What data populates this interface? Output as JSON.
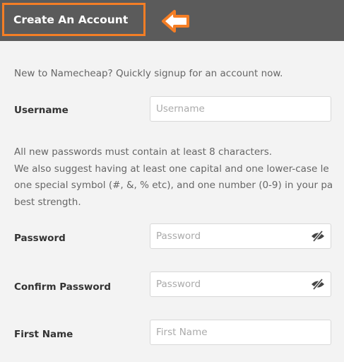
{
  "header": {
    "title": "Create An Account",
    "accent_color": "#f47e25",
    "bar_color": "#5b5b5b",
    "arrow_icon": "left-arrow-icon"
  },
  "intro_text": "New to Namecheap? Quickly signup for an account now.",
  "username": {
    "label": "Username",
    "placeholder": "Username",
    "value": ""
  },
  "password_help": [
    "All new passwords must contain at least 8 characters.",
    "We also suggest having at least one capital and one lower-case le",
    "one special symbol (#, &, % etc), and one number (0-9) in your pa",
    "best strength."
  ],
  "password": {
    "label": "Password",
    "placeholder": "Password",
    "value": "",
    "toggle_icon": "eye-slash-icon"
  },
  "confirm_password": {
    "label": "Confirm Password",
    "placeholder": "Password",
    "value": "",
    "toggle_icon": "eye-slash-icon"
  },
  "first_name": {
    "label": "First Name",
    "placeholder": "First Name",
    "value": ""
  }
}
